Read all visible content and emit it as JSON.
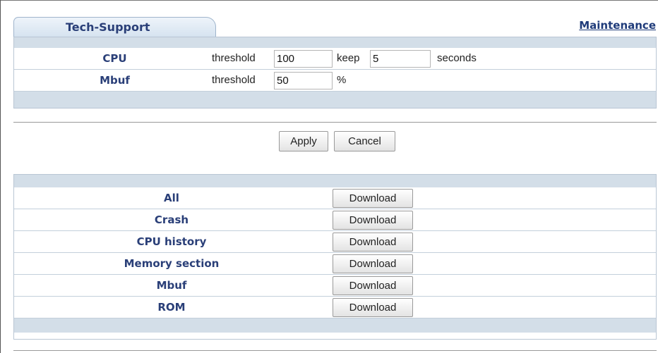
{
  "tab": {
    "label": "Tech-Support"
  },
  "maintenance_link": "Maintenance",
  "thresholds": {
    "cpu": {
      "label": "CPU",
      "threshold_label": "threshold",
      "threshold_value": "100",
      "keep_label": "keep",
      "keep_value": "5",
      "unit": "seconds"
    },
    "mbuf": {
      "label": "Mbuf",
      "threshold_label": "threshold",
      "threshold_value": "50",
      "unit": "%"
    }
  },
  "buttons": {
    "apply": "Apply",
    "cancel": "Cancel"
  },
  "downloads": [
    {
      "label": "All",
      "button": "Download"
    },
    {
      "label": "Crash",
      "button": "Download"
    },
    {
      "label": "CPU history",
      "button": "Download"
    },
    {
      "label": "Memory section",
      "button": "Download"
    },
    {
      "label": "Mbuf",
      "button": "Download"
    },
    {
      "label": "ROM",
      "button": "Download"
    }
  ]
}
